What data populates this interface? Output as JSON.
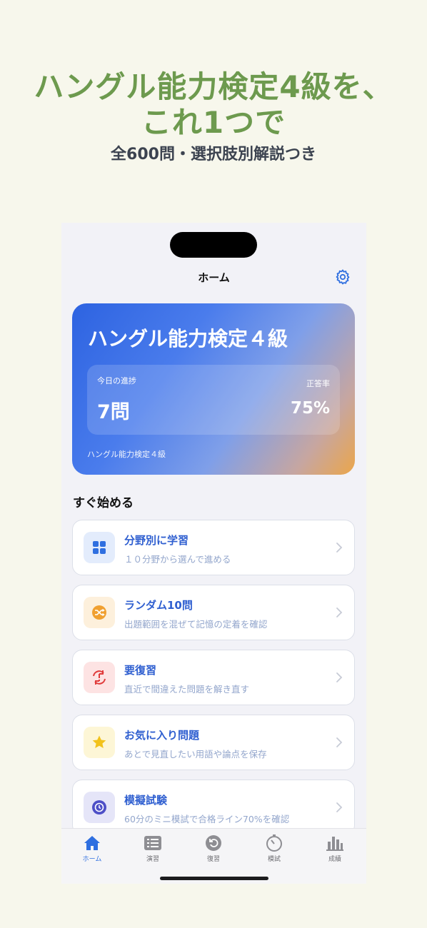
{
  "promo": {
    "headline_1": "ハングル能力検定4級を、",
    "headline_2": "これ1つで",
    "subheadline": "全600問・選択肢別解説つき"
  },
  "nav": {
    "title": "ホーム",
    "settings_icon": "gear-icon"
  },
  "hero": {
    "title": "ハングル能力検定４級",
    "progress_label": "今日の進捗",
    "progress_value": "7問",
    "accuracy_label": "正答率",
    "accuracy_value": "75%",
    "footer": "ハングル能力検定４級"
  },
  "quick_start": {
    "title": "すぐ始める",
    "items": [
      {
        "title": "分野別に学習",
        "subtitle": "１０分野から選んで進める",
        "icon": "grid-icon",
        "color": "#2f6fe0"
      },
      {
        "title": "ランダム10問",
        "subtitle": "出題範囲を混ぜて記憶の定着を確認",
        "icon": "shuffle-icon",
        "color": "#f0a030"
      },
      {
        "title": "要復習",
        "subtitle": "直近で間違えた問題を解き直す",
        "icon": "review-icon",
        "color": "#e03a3a"
      },
      {
        "title": "お気に入り問題",
        "subtitle": "あとで見直したい用語や論点を保存",
        "icon": "star-icon",
        "color": "#f2c21b"
      },
      {
        "title": "模擬試験",
        "subtitle": "60分のミニ模試で合格ライン70%を確認",
        "icon": "timer-icon",
        "color": "#4d4fc7"
      }
    ]
  },
  "tabs": [
    {
      "label": "ホーム",
      "icon": "home-icon",
      "active": true
    },
    {
      "label": "演習",
      "icon": "list-icon",
      "active": false
    },
    {
      "label": "復習",
      "icon": "review-icon",
      "active": false
    },
    {
      "label": "模試",
      "icon": "timer-icon",
      "active": false
    },
    {
      "label": "成績",
      "icon": "chart-icon",
      "active": false
    }
  ]
}
